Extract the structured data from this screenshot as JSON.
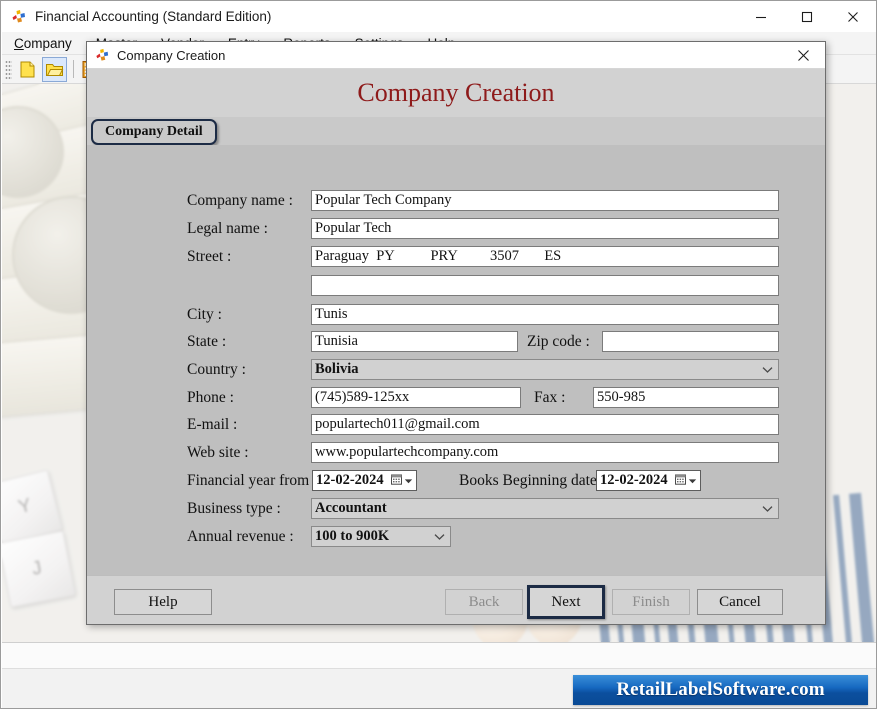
{
  "app": {
    "title": "Financial Accounting (Standard Edition)",
    "icon": "app-logo-icon",
    "window_controls": {
      "minimize": "minimize-icon",
      "maximize": "maximize-icon",
      "close": "close-icon"
    },
    "menu": [
      {
        "label": "Company",
        "accel": "C"
      },
      {
        "label": "Master",
        "accel": "M"
      },
      {
        "label": "Vendor",
        "accel": "V"
      },
      {
        "label": "Entry",
        "accel": "E"
      },
      {
        "label": "Reports",
        "accel": "R"
      },
      {
        "label": "Settings",
        "accel": "S"
      },
      {
        "label": "Help",
        "accel": "H"
      }
    ],
    "toolbar": [
      {
        "name": "new-company-icon",
        "title": "New Company"
      },
      {
        "name": "open-company-icon",
        "title": "Open Company"
      },
      {
        "name": "calculator-icon",
        "title": "Calculator"
      }
    ]
  },
  "dialog": {
    "titlebar": {
      "icon": "app-logo-icon",
      "title": "Company Creation",
      "close": "close-icon"
    },
    "header": "Company Creation",
    "tabs": [
      {
        "label": "Company Detail",
        "active": true
      }
    ],
    "fields": {
      "company_name": {
        "label": "Company name :",
        "value": "Popular Tech Company",
        "placeholder": ""
      },
      "legal_name": {
        "label": "Legal name :",
        "value": "Popular Tech",
        "placeholder": ""
      },
      "street": {
        "label": "Street :",
        "value": "Paraguay  PY          PRY         3507       ES",
        "placeholder": ""
      },
      "street2": {
        "label": "",
        "value": "",
        "placeholder": ""
      },
      "city": {
        "label": "City :",
        "value": "Tunis",
        "placeholder": ""
      },
      "state": {
        "label": "State :",
        "value": "Tunisia",
        "placeholder": ""
      },
      "zip_code": {
        "label": "Zip code :",
        "value": "",
        "placeholder": ""
      },
      "country": {
        "label": "Country :",
        "value": "Bolivia",
        "type": "combobox"
      },
      "phone": {
        "label": "Phone :",
        "value": "(745)589-125xx",
        "placeholder": ""
      },
      "fax": {
        "label": "Fax :",
        "value": "550-985",
        "placeholder": ""
      },
      "email": {
        "label": "E-mail :",
        "value": "populartech011@gmail.com",
        "placeholder": ""
      },
      "website": {
        "label": "Web site :",
        "value": "www.populartechcompany.com",
        "placeholder": ""
      },
      "financial_year_from": {
        "label": "Financial year from :",
        "value": "12-02-2024",
        "type": "datepicker"
      },
      "books_beginning_date": {
        "label": "Books Beginning date:",
        "value": "12-02-2024",
        "type": "datepicker"
      },
      "business_type": {
        "label": "Business type :",
        "value": "Accountant",
        "type": "combobox"
      },
      "annual_revenue": {
        "label": "Annual revenue :",
        "value": "100 to 900K",
        "type": "combobox"
      }
    },
    "buttons": {
      "help": {
        "label": "Help",
        "state": "enabled"
      },
      "back": {
        "label": "Back",
        "state": "disabled"
      },
      "next": {
        "label": "Next",
        "state": "focused"
      },
      "finish": {
        "label": "Finish",
        "state": "disabled"
      },
      "cancel": {
        "label": "Cancel",
        "state": "enabled"
      }
    }
  },
  "watermark": {
    "text": "RetailLabelSoftware.com"
  },
  "colors": {
    "header_text": "#8e1a1a",
    "dialog_bg": "#bfbfbf",
    "tab_border": "#1c2b45",
    "watermark_bg": "#1668c0",
    "watermark_text": "#ffffff"
  }
}
